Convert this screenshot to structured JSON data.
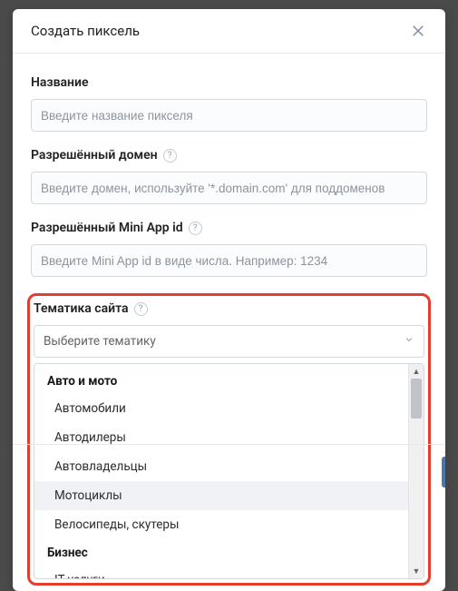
{
  "modal": {
    "title": "Создать пиксель"
  },
  "fields": {
    "name": {
      "label": "Название",
      "placeholder": "Введите название пикселя"
    },
    "domain": {
      "label": "Разрешённый домен",
      "placeholder": "Введите домен, используйте '*.domain.com' для поддоменов"
    },
    "miniapp": {
      "label": "Разрешённый Mini App id",
      "placeholder": "Введите Mini App id в виде числа. Например: 1234"
    },
    "topic": {
      "label": "Тематика сайта",
      "select_placeholder": "Выберите тематику"
    }
  },
  "dropdown": {
    "groups": [
      {
        "title": "Авто и мото",
        "items": [
          {
            "label": "Автомобили",
            "hover": false
          },
          {
            "label": "Автодилеры",
            "hover": false
          },
          {
            "label": "Автовладельцы",
            "hover": false
          },
          {
            "label": "Мотоциклы",
            "hover": true
          },
          {
            "label": "Велосипеды, скутеры",
            "hover": false
          }
        ]
      },
      {
        "title": "Бизнес",
        "items": [
          {
            "label": "IT услуги",
            "hover": false
          }
        ]
      }
    ]
  }
}
